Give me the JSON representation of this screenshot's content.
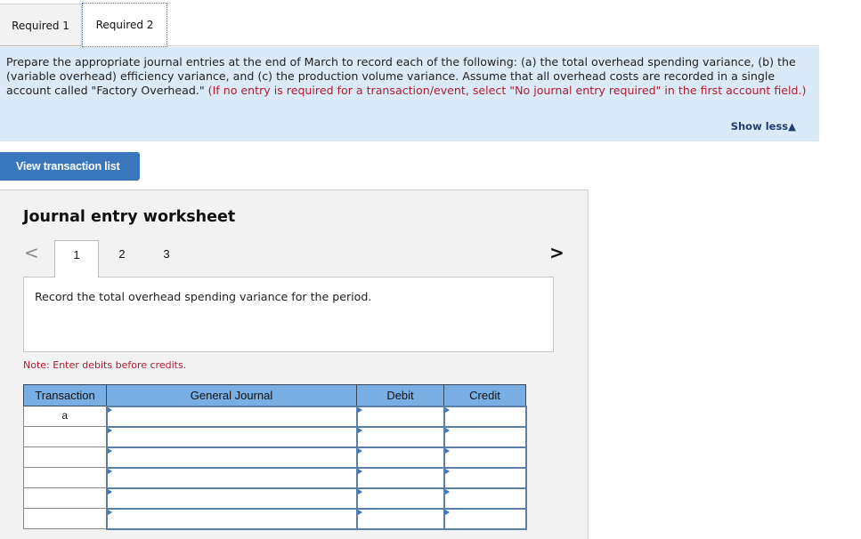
{
  "tabs": [
    {
      "label": "Required 1",
      "active": false
    },
    {
      "label": "Required 2",
      "active": true
    }
  ],
  "instructions": {
    "text": "Prepare the appropriate journal entries at the end of March to record each of the following: (a) the total overhead spending variance, (b) the (variable overhead) efficiency variance, and (c) the production volume variance. Assume that all overhead costs are recorded in a single account called \"Factory Overhead.\" ",
    "note": "(If no entry is required for a transaction/event, select \"No journal entry required\" in the first account field.)",
    "toggle_label": "Show less",
    "toggle_icon": "triangle-up"
  },
  "view_transaction_button": "View transaction list",
  "worksheet": {
    "title": "Journal entry worksheet",
    "prev_icon": "chevron-left",
    "next_icon": "chevron-right",
    "steps": [
      "1",
      "2",
      "3"
    ],
    "active_step": "1",
    "prompt": "Record the total overhead spending variance for the period.",
    "note": "Note: Enter debits before credits.",
    "table": {
      "headers": [
        "Transaction",
        "General Journal",
        "Debit",
        "Credit"
      ],
      "rows": [
        {
          "transaction": "a",
          "account": "",
          "debit": "",
          "credit": ""
        },
        {
          "transaction": "",
          "account": "",
          "debit": "",
          "credit": ""
        },
        {
          "transaction": "",
          "account": "",
          "debit": "",
          "credit": ""
        },
        {
          "transaction": "",
          "account": "",
          "debit": "",
          "credit": ""
        },
        {
          "transaction": "",
          "account": "",
          "debit": "",
          "credit": ""
        },
        {
          "transaction": "",
          "account": "",
          "debit": "",
          "credit": ""
        }
      ]
    }
  },
  "colors": {
    "instructions_bg": "#dbeaf8",
    "accent_blue": "#3a76bb",
    "table_header_bg": "#79aee2",
    "note_red": "#b01c2e",
    "panel_bg": "#f2f2f2"
  }
}
